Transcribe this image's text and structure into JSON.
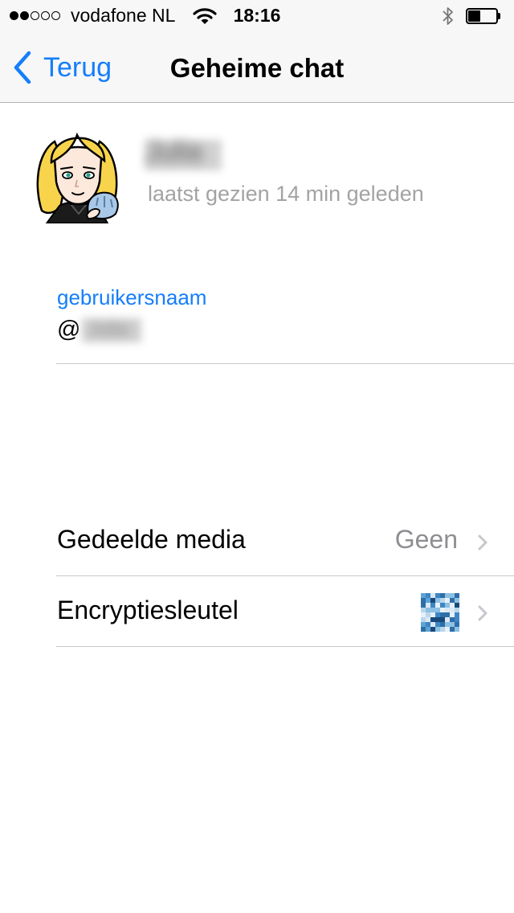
{
  "status_bar": {
    "signal_strength": 2,
    "signal_max": 5,
    "carrier": "vodafone NL",
    "time": "18:16",
    "battery_level": 0.45
  },
  "nav": {
    "back_label": "Terug",
    "title": "Geheime chat"
  },
  "profile": {
    "name": "Julia",
    "last_seen": "laatst gezien 14 min geleden"
  },
  "username": {
    "label": "gebruikersnaam",
    "prefix": "@",
    "value": "Julia"
  },
  "rows": [
    {
      "label": "Gedeelde media",
      "value": "Geen"
    },
    {
      "label": "Encryptiesleutel",
      "value": ""
    }
  ],
  "colors": {
    "accent": "#147efb",
    "secondary_text": "#a3a3a3",
    "separator": "#c8c7cc",
    "bar_background": "#f7f7f8"
  }
}
